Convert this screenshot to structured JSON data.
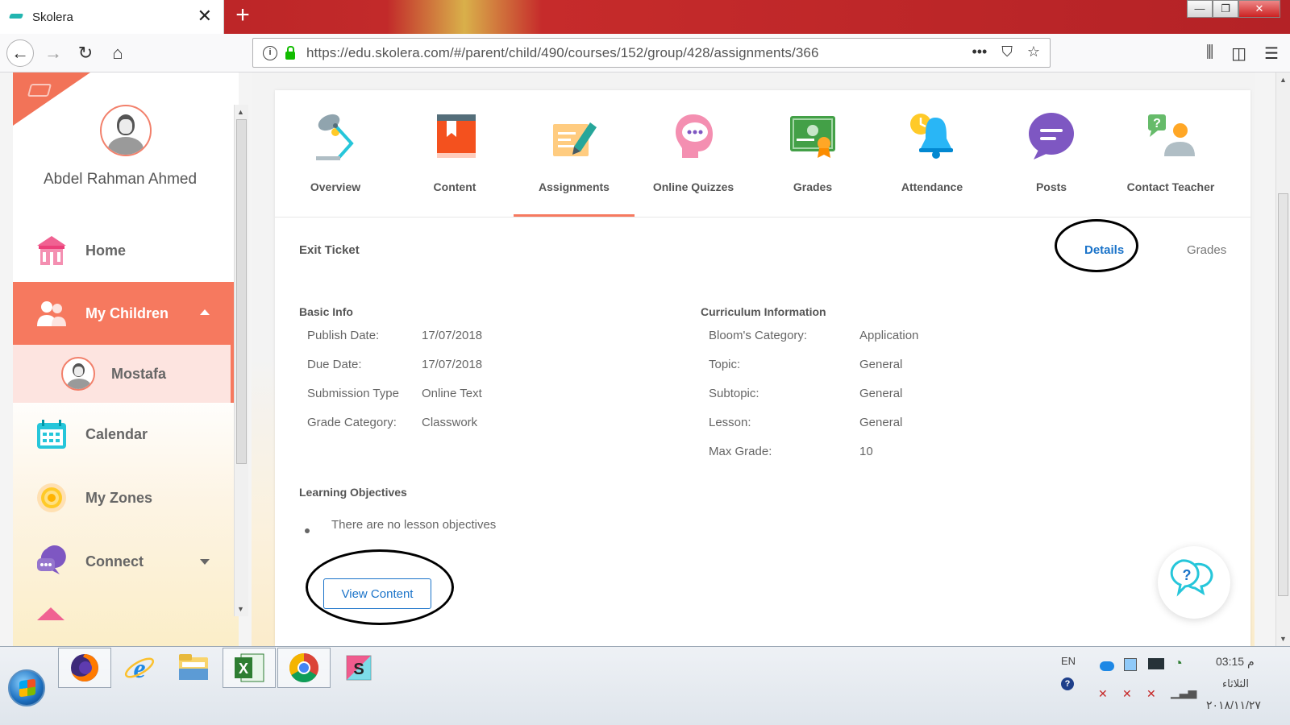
{
  "browser": {
    "tab_title": "Skolera",
    "new_tab": "+",
    "tab_close": "✕",
    "url": "https://edu.skolera.com/#/parent/child/490/courses/152/group/428/assignments/366",
    "window_min": "—",
    "window_max": "❐",
    "window_close": "✕",
    "back": "←",
    "forward": "→",
    "reload": "↻",
    "home": "⌂",
    "url_more": "•••",
    "pocket": "⛉",
    "bookmark": "☆",
    "library": "⫼",
    "sidebar_toggle": "◫",
    "menu": "☰"
  },
  "sidebar": {
    "user_name": "Abdel Rahman Ahmed",
    "items": [
      {
        "label": "Home",
        "icon": "school-icon"
      },
      {
        "label": "My Children",
        "icon": "children-icon"
      },
      {
        "label": "Mostafa",
        "icon": "child-avatar"
      },
      {
        "label": "Calendar",
        "icon": "calendar-icon"
      },
      {
        "label": "My Zones",
        "icon": "zones-icon"
      },
      {
        "label": "Connect",
        "icon": "connect-icon"
      }
    ]
  },
  "course_tabs": [
    {
      "label": "Overview",
      "icon": "lamp-icon"
    },
    {
      "label": "Content",
      "icon": "book-icon"
    },
    {
      "label": "Assignments",
      "icon": "assignment-pen-icon"
    },
    {
      "label": "Online Quizzes",
      "icon": "quiz-head-icon"
    },
    {
      "label": "Grades",
      "icon": "certificate-icon"
    },
    {
      "label": "Attendance",
      "icon": "bell-clock-icon"
    },
    {
      "label": "Posts",
      "icon": "chat-bubble-icon"
    },
    {
      "label": "Contact Teacher",
      "icon": "contact-teacher-icon"
    }
  ],
  "active_tab": "Assignments",
  "assignment": {
    "title": "Exit Ticket",
    "subtabs": {
      "details": "Details",
      "grades": "Grades"
    },
    "basic_info": {
      "heading": "Basic Info",
      "rows": [
        {
          "label": "Publish Date:",
          "value": "17/07/2018"
        },
        {
          "label": "Due Date:",
          "value": "17/07/2018"
        },
        {
          "label": "Submission Type",
          "value": "Online Text"
        },
        {
          "label": "Grade Category:",
          "value": "Classwork"
        }
      ]
    },
    "curriculum": {
      "heading": "Curriculum Information",
      "rows": [
        {
          "label": "Bloom's Category:",
          "value": "Application"
        },
        {
          "label": "Topic:",
          "value": "General"
        },
        {
          "label": "Subtopic:",
          "value": "General"
        },
        {
          "label": "Lesson:",
          "value": "General"
        },
        {
          "label": "Max Grade:",
          "value": "10"
        }
      ]
    },
    "objectives": {
      "heading": "Learning Objectives",
      "items": [
        "There are no lesson objectives"
      ]
    },
    "view_content_label": "View Content"
  },
  "help_mark": "?",
  "taskbar": {
    "apps": [
      "firefox-icon",
      "internet-explorer-icon",
      "file-explorer-icon",
      "excel-icon",
      "chrome-icon",
      "skolera-s-icon"
    ],
    "lang": "EN",
    "time": "03:15 م",
    "day": "الثلاثاء",
    "date": "٢٠١٨/١١/٢٧",
    "excel_letter": "X",
    "skolera_letter": "S"
  },
  "colors": {
    "accent": "#f6795f",
    "link_blue": "#1a73c9",
    "child_bg": "#fde4e0"
  }
}
